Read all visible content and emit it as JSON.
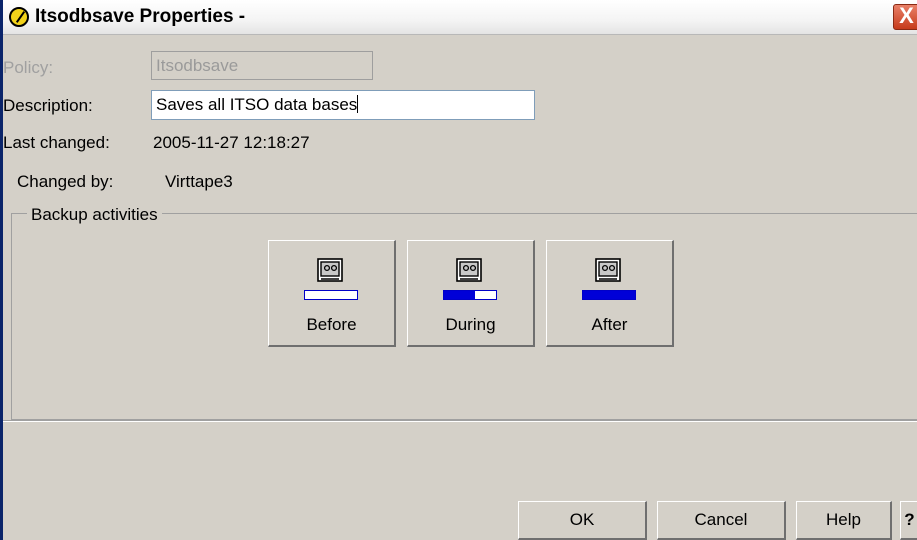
{
  "window": {
    "title": "Itsodbsave Properties -",
    "close_glyph": "X"
  },
  "form": {
    "policy_label": "Policy:",
    "policy_value": "Itsodbsave",
    "description_label": "Description:",
    "description_value": "Saves all ITSO data bases",
    "last_changed_label": "Last changed:",
    "last_changed_value": "2005-11-27 12:18:27",
    "changed_by_label": "Changed by:",
    "changed_by_value": "Virttape3"
  },
  "backup": {
    "group_label": "Backup activities",
    "activities": [
      {
        "label": "Before",
        "icon": "tape-drive-icon",
        "progress": 0.0
      },
      {
        "label": "During",
        "icon": "tape-drive-icon",
        "progress": 0.6
      },
      {
        "label": "After",
        "icon": "tape-drive-icon",
        "progress": 1.0
      }
    ]
  },
  "buttons": {
    "ok": "OK",
    "cancel": "Cancel",
    "help": "Help",
    "whats_this": "?"
  },
  "colors": {
    "progress_fill": "#0000d8",
    "title_icon": "#f2d21a",
    "close_button": "#c63b1b"
  }
}
